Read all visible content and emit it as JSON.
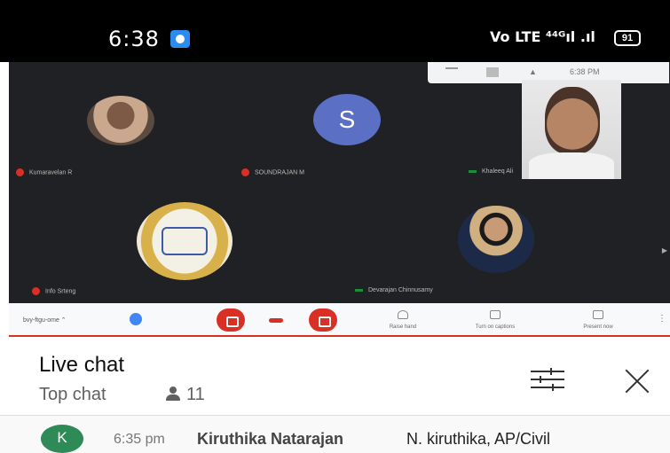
{
  "status_bar": {
    "time": "6:38",
    "network": "Vo LTE ⁴⁴ᴳıl .ıl",
    "battery": "91"
  },
  "meeting": {
    "top_strip_time": "6:38 PM",
    "participants": [
      {
        "name": "Kumaravelan R",
        "muted": true
      },
      {
        "name": "SOUNDRAJAN M",
        "muted": true,
        "initial": "S"
      },
      {
        "name": "Khaleeq Ali",
        "muted": false
      },
      {
        "name": "Info Srteng",
        "muted": true
      },
      {
        "name": "Devarajan Chinnusamy",
        "muted": false
      }
    ],
    "controls": {
      "meeting_code": "bvy-ftgu-ome",
      "raise_hand": "Raise hand",
      "captions": "Turn on captions",
      "present": "Present now"
    }
  },
  "chat": {
    "title": "Live chat",
    "mode": "Top chat",
    "viewer_count": "11",
    "messages": [
      {
        "avatar_initial": "K",
        "avatar_color": "#2e8b57",
        "time": "6:35 pm",
        "author": "Kiruthika Natarajan",
        "text": "N. kiruthika, AP/Civil"
      }
    ]
  }
}
